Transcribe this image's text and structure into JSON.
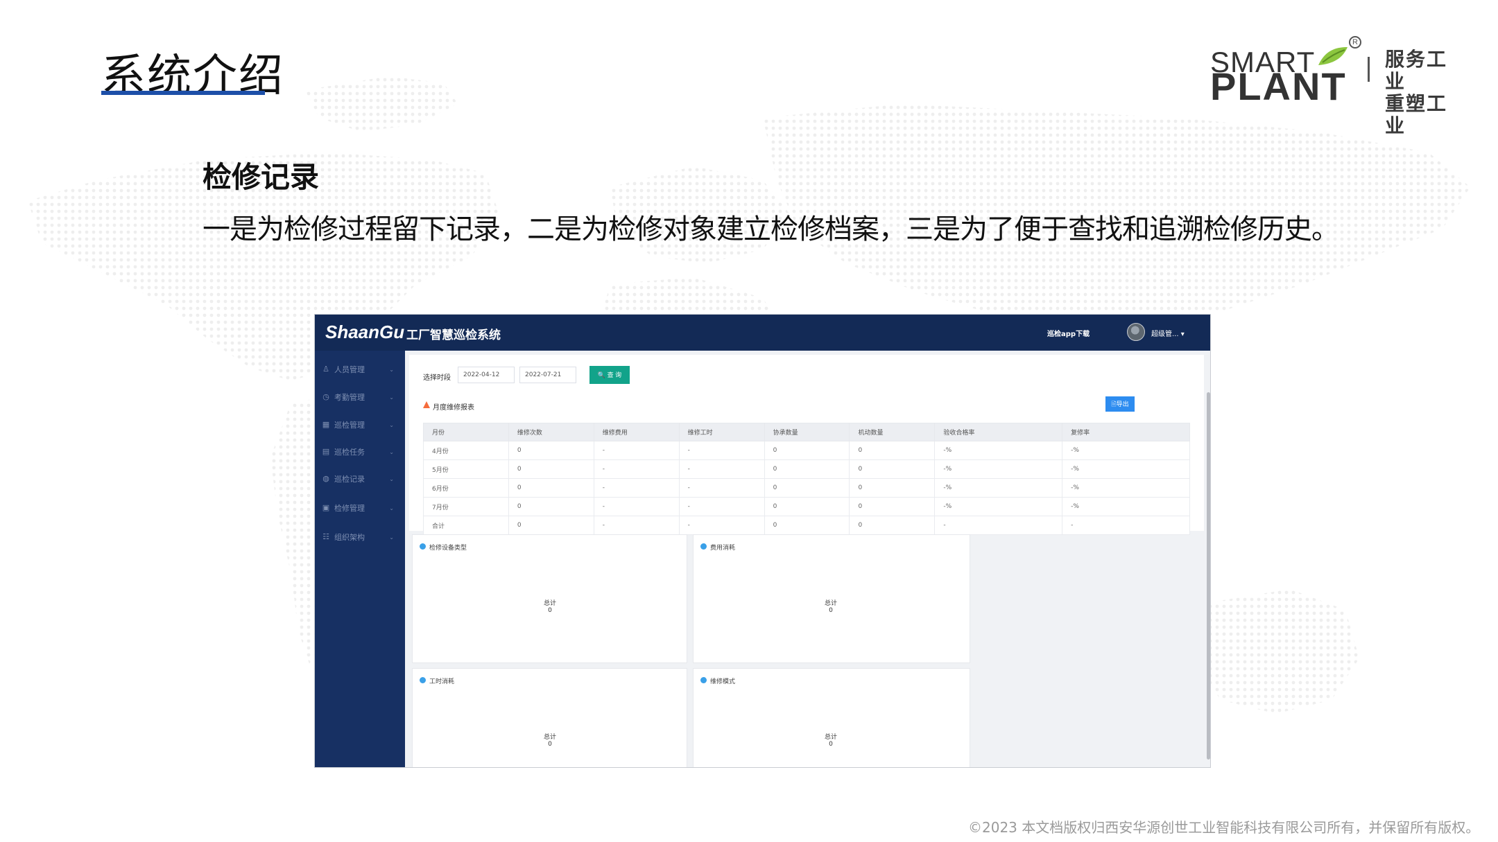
{
  "slide": {
    "title": "系统介绍",
    "brand_line1": "SMART",
    "brand_line2": "PLANT",
    "brand_reg": "R",
    "slogan_line1": "服务工业",
    "slogan_line2": "重塑工业",
    "section_title": "检修记录",
    "section_desc": "一是为检修过程留下记录，二是为检修对象建立检修档案，三是为了便于查找和追溯检修历史。",
    "copyright": "©2023 本文档版权归西安华源创世工业智能科技有限公司所有，并保留所有版权。",
    "accent_color": "#1d4fa8"
  },
  "app": {
    "logo": "ShaanGu",
    "title": "工厂智慧巡检系统",
    "download_label": "巡检app下载",
    "user_label": "超级管... ▾",
    "header_color": "#132a56",
    "sidebar_color": "#173063",
    "sidebar": {
      "items": [
        {
          "icon": "person-icon",
          "glyph": "♙",
          "label": "人员管理"
        },
        {
          "icon": "clock-icon",
          "glyph": "◷",
          "label": "考勤管理"
        },
        {
          "icon": "grid-icon",
          "glyph": "▦",
          "label": "巡检管理"
        },
        {
          "icon": "calendar-icon",
          "glyph": "▤",
          "label": "巡检任务"
        },
        {
          "icon": "record-icon",
          "glyph": "◍",
          "label": "巡检记录"
        },
        {
          "icon": "document-icon",
          "glyph": "▣",
          "label": "检修管理"
        },
        {
          "icon": "org-icon",
          "glyph": "☷",
          "label": "组织架构"
        }
      ],
      "arrow": "⌄"
    },
    "filter": {
      "label": "选择时段",
      "start_date": "2022-04-12",
      "end_date": "2022-07-21",
      "query_label": "🔍 查 询"
    },
    "report": {
      "title": "月度维修报表",
      "export_label": "🗎导出",
      "columns": [
        "月份",
        "维修次数",
        "维修费用",
        "维修工时",
        "协承数量",
        "机动数量",
        "验收合格率",
        "复修率"
      ],
      "rows": [
        [
          "4月份",
          "0",
          "-",
          "-",
          "0",
          "0",
          "-%",
          "-%"
        ],
        [
          "5月份",
          "0",
          "-",
          "-",
          "0",
          "0",
          "-%",
          "-%"
        ],
        [
          "6月份",
          "0",
          "-",
          "-",
          "0",
          "0",
          "-%",
          "-%"
        ],
        [
          "7月份",
          "0",
          "-",
          "-",
          "0",
          "0",
          "-%",
          "-%"
        ],
        [
          "合计",
          "0",
          "-",
          "-",
          "0",
          "0",
          "-",
          "-"
        ]
      ]
    },
    "charts": [
      {
        "title": "检修设备类型",
        "total_label": "总计",
        "total_value": "0"
      },
      {
        "title": "费用消耗",
        "total_label": "总计",
        "total_value": "0"
      },
      {
        "title": "工时消耗",
        "total_label": "总计",
        "total_value": "0"
      },
      {
        "title": "维修模式",
        "total_label": "总计",
        "total_value": "0"
      }
    ]
  }
}
